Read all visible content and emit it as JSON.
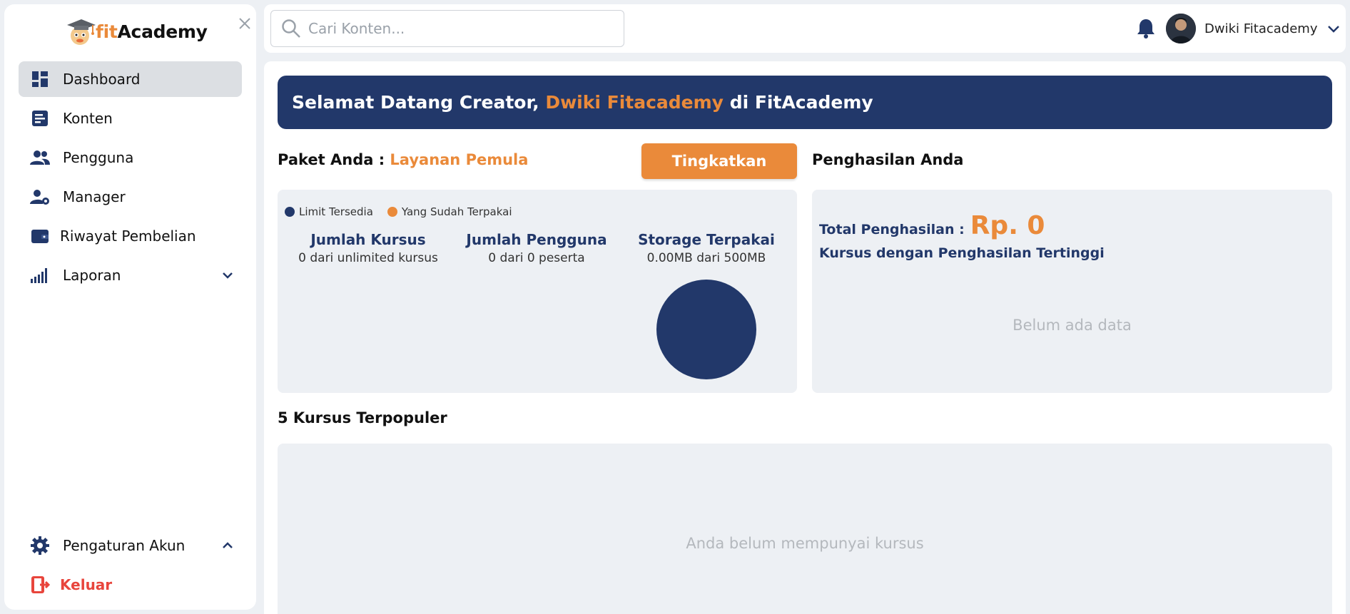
{
  "brand": {
    "name_prefix": "fit",
    "name_suffix": "Academy"
  },
  "sidebar": {
    "items": [
      {
        "label": "Dashboard",
        "icon": "dashboard-icon",
        "active": true
      },
      {
        "label": "Konten",
        "icon": "content-icon"
      },
      {
        "label": "Pengguna",
        "icon": "users-icon"
      },
      {
        "label": "Manager",
        "icon": "manager-icon"
      },
      {
        "label": "Riwayat Pembelian",
        "icon": "wallet-icon"
      },
      {
        "label": "Laporan",
        "icon": "signal-bars-icon",
        "expand": "chevron-down-icon"
      }
    ],
    "settings": {
      "label": "Pengaturan Akun",
      "icon": "gear-icon",
      "expand": "chevron-up-icon"
    },
    "logout": {
      "label": "Keluar",
      "icon": "logout-icon"
    }
  },
  "search": {
    "placeholder": "Cari Konten..."
  },
  "user": {
    "name": "Dwiki Fitacademy"
  },
  "welcome": {
    "prefix": "Selamat Datang Creator, ",
    "name": "Dwiki Fitacademy",
    "suffix": " di FitAcademy"
  },
  "paket": {
    "label": "Paket Anda : ",
    "value": "Layanan Pemula",
    "upgrade_label": "Tingkatkan"
  },
  "legend": {
    "available": "Limit Tersedia",
    "used": "Yang Sudah Terpakai"
  },
  "stats": [
    {
      "title": "Jumlah Kursus",
      "sub": "0 dari unlimited kursus"
    },
    {
      "title": "Jumlah Pengguna",
      "sub": "0 dari 0 peserta"
    },
    {
      "title": "Storage Terpakai",
      "sub": "0.00MB dari 500MB"
    }
  ],
  "chart_data": {
    "type": "pie",
    "categories": [
      "Limit Tersedia",
      "Yang Sudah Terpakai"
    ],
    "values": [
      500,
      0
    ]
  },
  "income": {
    "title": "Penghasilan Anda",
    "total_label": "Total Penghasilan :",
    "total_value": "Rp. 0",
    "top_course_label": "Kursus dengan Penghasilan Tertinggi",
    "empty": "Belum ada data"
  },
  "popular": {
    "title": "5 Kursus Terpopuler",
    "empty": "Anda belum mempunyai kursus"
  },
  "colors": {
    "navy": "#22386a",
    "orange": "#ea8a3a",
    "logout_red": "#e8453c"
  }
}
